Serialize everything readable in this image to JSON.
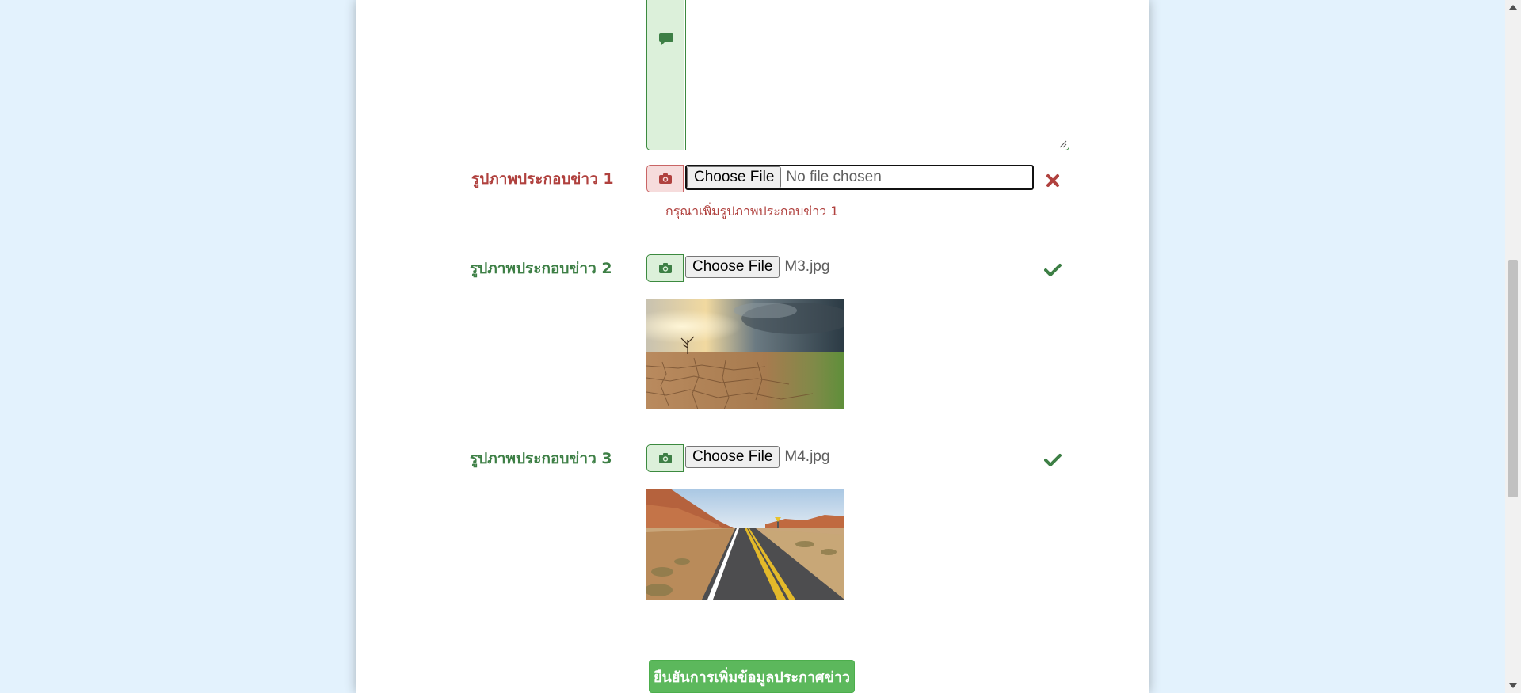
{
  "form": {
    "image1": {
      "label": "รูปภาพประกอบข่าว 1",
      "button": "Choose File",
      "file_name": "No file chosen",
      "error": "กรุณาเพิ่มรูปภาพประกอบข่าว 1",
      "status_icon": "times-icon"
    },
    "image2": {
      "label": "รูปภาพประกอบข่าว 2",
      "button": "Choose File",
      "file_name": "M3.jpg",
      "status_icon": "check-icon"
    },
    "image3": {
      "label": "รูปภาพประกอบข่าว 3",
      "button": "Choose File",
      "file_name": "M4.jpg",
      "status_icon": "check-icon"
    },
    "submit_label": "ยืนยันการเพิ่มข้อมูลประกาศข่าว"
  },
  "icons": {
    "textarea_addon": "comment-icon",
    "image_addon": "camera-icon"
  },
  "colors": {
    "page_bg": "#e3f2fd",
    "valid": "#3d7f45",
    "invalid": "#b0413e",
    "submit": "#5cb85c"
  }
}
